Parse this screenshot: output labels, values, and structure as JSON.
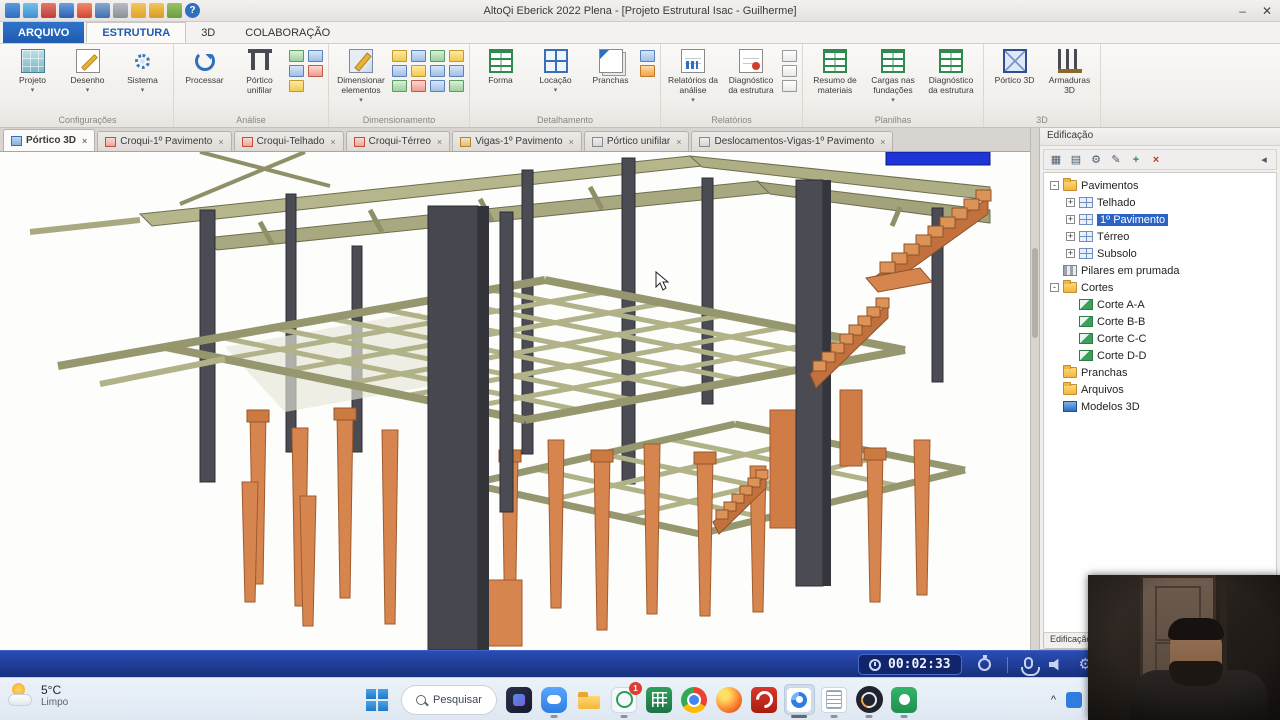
{
  "window": {
    "title": "AltoQi Eberick 2022 Plena - [Projeto Estrutural Isac - Guilherme]",
    "minimize_label": "–",
    "close_label": "✕"
  },
  "icons": {
    "dropdown": "▾",
    "close_tab": "×",
    "tree_collapse": "-",
    "tree_expand": "+",
    "gear": "⚙",
    "tray_chevron": "^",
    "help": "?"
  },
  "ribbon": {
    "tabs": [
      "ARQUIVO",
      "ESTRUTURA",
      "3D",
      "COLABORAÇÃO"
    ],
    "groups": [
      {
        "name": "Configurações",
        "buttons": [
          "Projeto",
          "Desenho",
          "Sistema"
        ]
      },
      {
        "name": "Análise",
        "buttons": [
          "Processar",
          "Pórtico unifilar"
        ]
      },
      {
        "name": "Dimensionamento",
        "buttons": [
          "Dimensionar elementos"
        ]
      },
      {
        "name": "Detalhamento",
        "buttons": [
          "Forma",
          "Locação",
          "Pranchas"
        ]
      },
      {
        "name": "Relatórios",
        "buttons": [
          "Relatórios da análise",
          "Diagnóstico da estrutura"
        ]
      },
      {
        "name": "Planilhas",
        "buttons": [
          "Resumo de materiais",
          "Cargas nas fundações",
          "Diagnóstico da estrutura"
        ]
      },
      {
        "name": "3D",
        "buttons": [
          "Pórtico 3D",
          "Armaduras 3D"
        ]
      }
    ]
  },
  "doc_tabs": [
    "Pórtico 3D",
    "Croqui-1º Pavimento",
    "Croqui-Telhado",
    "Croqui-Térreo",
    "Vigas-1º Pavimento",
    "Pórtico unifilar",
    "Deslocamentos-Vigas-1º Pavimento"
  ],
  "panel": {
    "title": "Edificação",
    "bottom_tab": "Edificação",
    "toolbar": [
      "▦",
      "▤",
      "⚙",
      "✎",
      "+",
      "×",
      "◂"
    ],
    "tree": [
      "Pavimentos",
      "Telhado",
      "1º Pavimento",
      "Térreo",
      "Subsolo",
      "Pilares em prumada",
      "Cortes",
      "Corte A-A",
      "Corte B-B",
      "Corte C-C",
      "Corte D-D",
      "Pranchas",
      "Arquivos",
      "Modelos 3D"
    ],
    "selected_item": "1º Pavimento"
  },
  "recorder": {
    "time": "00:02:33"
  },
  "taskbar": {
    "weather_temp": "5°C",
    "weather_desc": "Limpo",
    "search_label": "Pesquisar",
    "notification_badge": "1"
  },
  "colors": {
    "accent_blue": "#2a64c5",
    "beam_olive": "#b2b289",
    "column_gray": "#47474f",
    "pile_orange": "#d6854f",
    "recorder_blue": "#16307c"
  }
}
